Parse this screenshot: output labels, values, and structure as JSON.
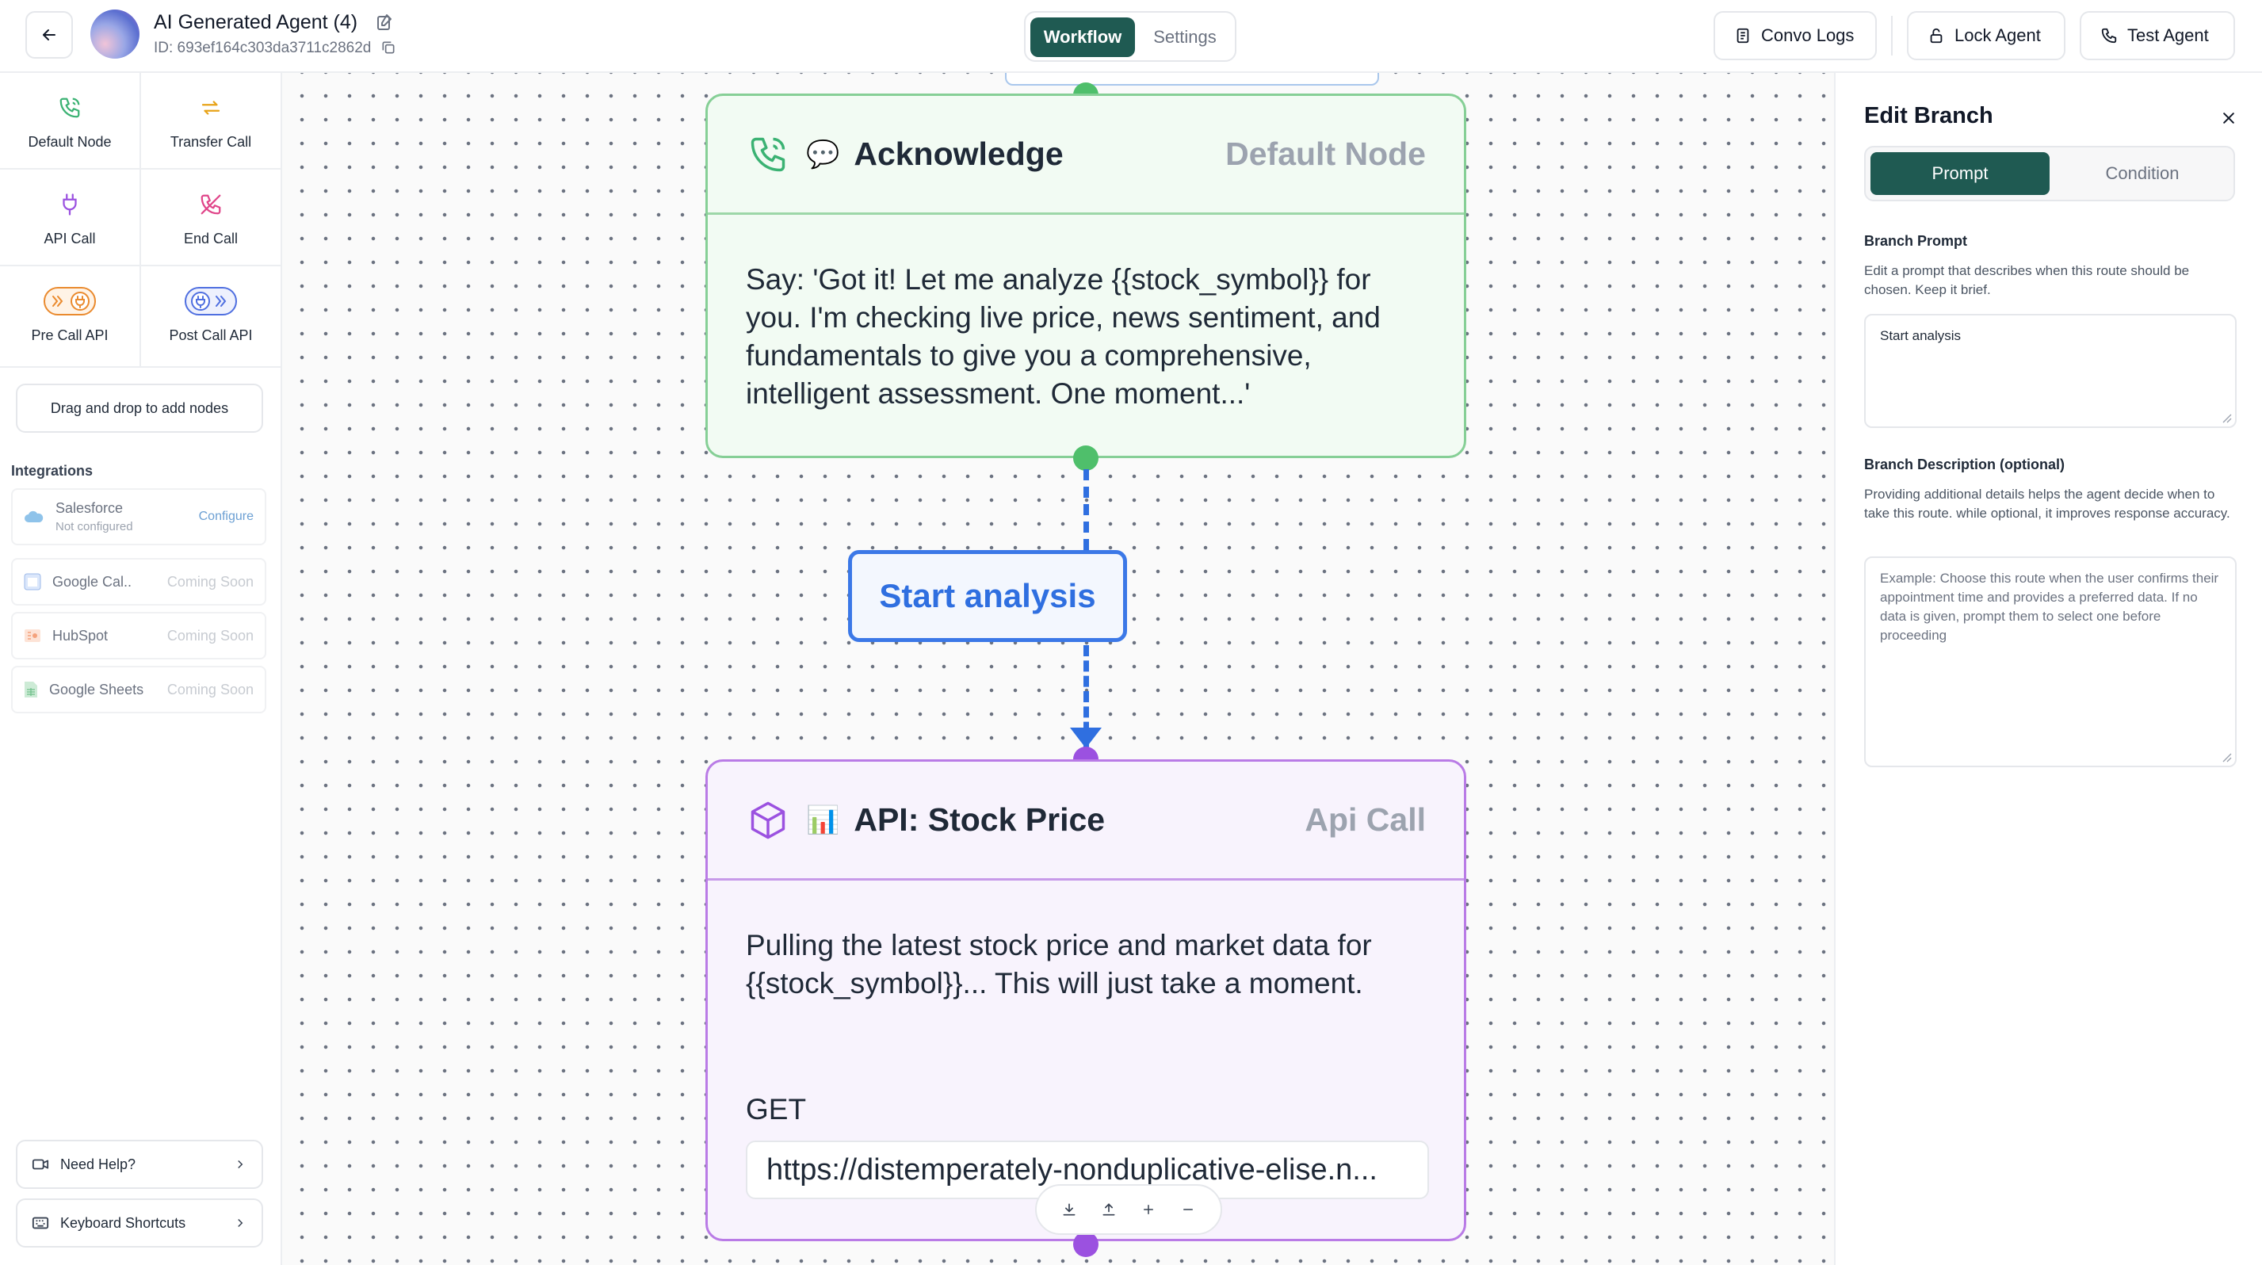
{
  "header": {
    "agent_title": "AI Generated Agent (4)",
    "agent_id": "ID: 693ef164c303da3711c2862d",
    "tabs": {
      "workflow": "Workflow",
      "settings": "Settings"
    },
    "actions": {
      "convo_logs": "Convo Logs",
      "lock_agent": "Lock Agent",
      "test_agent": "Test Agent"
    }
  },
  "sidebar": {
    "nodes": [
      {
        "label": "Default Node",
        "icon": "phone-icon",
        "color": "#3bb273"
      },
      {
        "label": "Transfer Call",
        "icon": "transfer-arrows-icon",
        "color": "#e8a317"
      },
      {
        "label": "API Call",
        "icon": "plug-icon",
        "color": "#9b51e0"
      },
      {
        "label": "End Call",
        "icon": "phone-off-icon",
        "color": "#e0468a"
      },
      {
        "label": "Pre Call API",
        "icon": "pre-call-api-icon",
        "color": "#ea8a2e"
      },
      {
        "label": "Post Call API",
        "icon": "post-call-api-icon",
        "color": "#4f6fe0"
      }
    ],
    "drag_hint": "Drag and drop to add nodes",
    "integrations_title": "Integrations",
    "integrations": [
      {
        "name": "Salesforce",
        "sub": "Not configured",
        "status": "Configure"
      },
      {
        "name": "Google Cal..",
        "status": "Coming Soon"
      },
      {
        "name": "HubSpot",
        "status": "Coming Soon"
      },
      {
        "name": "Google Sheets",
        "status": "Coming Soon"
      }
    ],
    "need_help": "Need Help?",
    "keyboard_shortcuts": "Keyboard Shortcuts"
  },
  "canvas": {
    "acknowledge_node": {
      "emoji": "💬",
      "title": "Acknowledge",
      "type": "Default Node",
      "body": "Say: 'Got it! Let me analyze {{stock_symbol}} for you. I'm checking live price, news sentiment, and fundamentals to give you a comprehensive, intelligent assessment. One moment...'"
    },
    "branch_label": "Start analysis",
    "api_node": {
      "emoji": "📊",
      "title": "API: Stock Price",
      "type": "Api Call",
      "body": "Pulling the latest stock price and market data for {{stock_symbol}}... This will just take a moment.",
      "method": "GET",
      "url": "https://distemperately-nonduplicative-elise.n..."
    },
    "colors": {
      "default_node": "#86cf96",
      "api_node": "#b97be6",
      "edge": "#2f6fe0"
    }
  },
  "panel": {
    "title": "Edit Branch",
    "tabs": {
      "prompt": "Prompt",
      "condition": "Condition"
    },
    "branch_prompt_label": "Branch Prompt",
    "branch_prompt_help": "Edit a prompt that describes when this route should be chosen. Keep it brief.",
    "branch_prompt_value": "Start analysis",
    "branch_desc_label": "Branch Description (optional)",
    "branch_desc_help": "Providing additional details helps the agent decide when to take this route. while optional, it improves response accuracy.",
    "branch_desc_placeholder": "Example: Choose this route when the user confirms their appointment time and provides a preferred data. If no data is given, prompt them to select one before proceeding"
  }
}
